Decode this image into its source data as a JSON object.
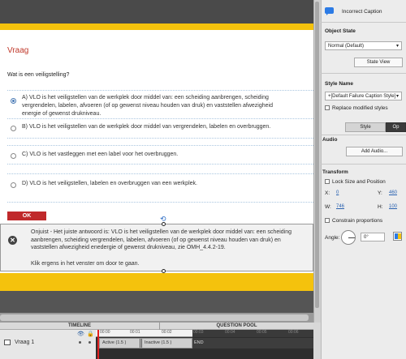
{
  "stage": {
    "slide_title": "Vraag",
    "question": "Wat is een veiligstelling?",
    "options": [
      {
        "line1": "A) VLO is het veiligstellen van de werkplek door middel van: een scheiding aanbrengen, scheiding",
        "line2": "vergrendelen, labelen, afvoeren (of op gewenst niveau houden van druk) en vaststellen afwezigheid",
        "line3": "energie of gewenst drukniveau.",
        "selected": true
      },
      {
        "line1": "B) VLO is het veiligstellen van de werkplek door middel van vergrendelen, labelen en overbruggen.",
        "selected": false
      },
      {
        "line1": "C) VLO is het vastleggen met een label voor het overbruggen.",
        "selected": false
      },
      {
        "line1": "D) VLO is het veiligstellen, labelen en overbruggen van een werkplek.",
        "selected": false
      }
    ],
    "ok_label": "OK",
    "caption": {
      "line1": "Onjuist - Het juiste antwoord is: VLO is het veiligstellen van de werkplek door middel van: een scheiding",
      "line2": "aanbrengen, scheiding vergrendelen, labelen, afvoeren (of op gewenst niveau houden van druk) en",
      "line3": "vaststellen afwezigheid enedergie of gewenst drukniveau, zie OMH_4.4.2-19.",
      "click": "Klik ergens in het venster om door te gaan."
    }
  },
  "timeline": {
    "tab_timeline": "TIMELINE",
    "tab_pool": "QUESTION POOL",
    "layer_name": "Vraag 1",
    "ruler": [
      "00:00",
      "00:01",
      "00:02",
      "00:03",
      "00:04",
      "00:05",
      "00:06"
    ],
    "active_label": "Active (1.5 )",
    "inactive_label": "Inactive (1.5 )",
    "end_label": "END"
  },
  "panel": {
    "title": "Incorrect Caption",
    "object_state_heading": "Object State",
    "state_select": "Normal (Default)",
    "state_view_btn": "State View",
    "style_name_heading": "Style Name",
    "style_select": "+[Default Failure Caption Style]",
    "replace_label": "Replace modified styles",
    "tab_style": "Style",
    "tab_options": "Op",
    "audio_heading": "Audio",
    "add_audio_btn": "Add Audio...",
    "transform_heading": "Transform",
    "lock_label": "Lock Size and Position",
    "x_label": "X:",
    "x_val": "0",
    "y_label": "Y:",
    "y_val": "460",
    "w_label": "W:",
    "w_val": "746",
    "h_label": "H:",
    "h_val": "100",
    "constrain_label": "Constrain proportions",
    "angle_label": "Angle:",
    "angle_val": "0°"
  }
}
